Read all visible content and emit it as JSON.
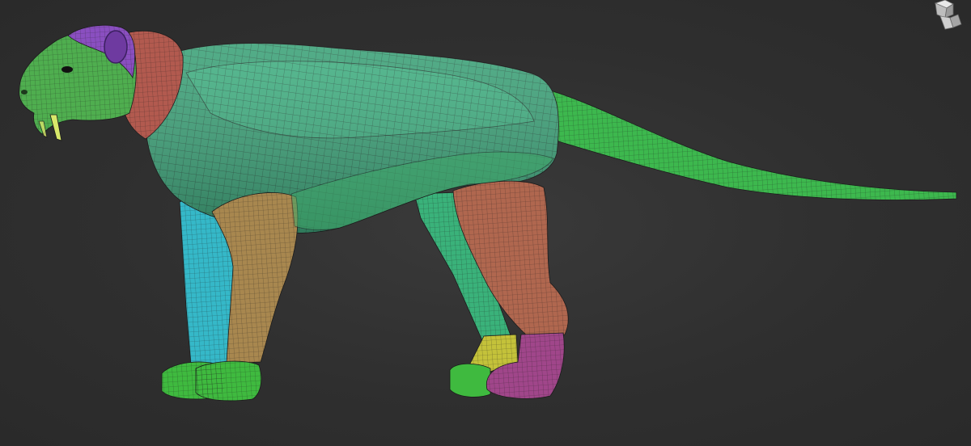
{
  "viewport": {
    "background": "#2f2f2f"
  },
  "model": {
    "polygroup_colors": {
      "head": "#4fae4f",
      "ear": "#8a4fc0",
      "neck": "#b25a4f",
      "torso": "#3fa37a",
      "torso_light": "#46b888",
      "belly": "#3fa86a",
      "tail": "#3db84e",
      "front_leg_far": "#35b8c8",
      "front_leg_near": "#a8874f",
      "front_paw": "#3fba3f",
      "rear_leg_near": "#b0674f",
      "rear_leg_far": "#3ab27a",
      "rear_paw_far": "#c4c23a",
      "rear_paw_near": "#a0468a",
      "fang": "#d8e86a"
    }
  },
  "gizmo": {
    "icon": "navigation-cube-icon"
  }
}
